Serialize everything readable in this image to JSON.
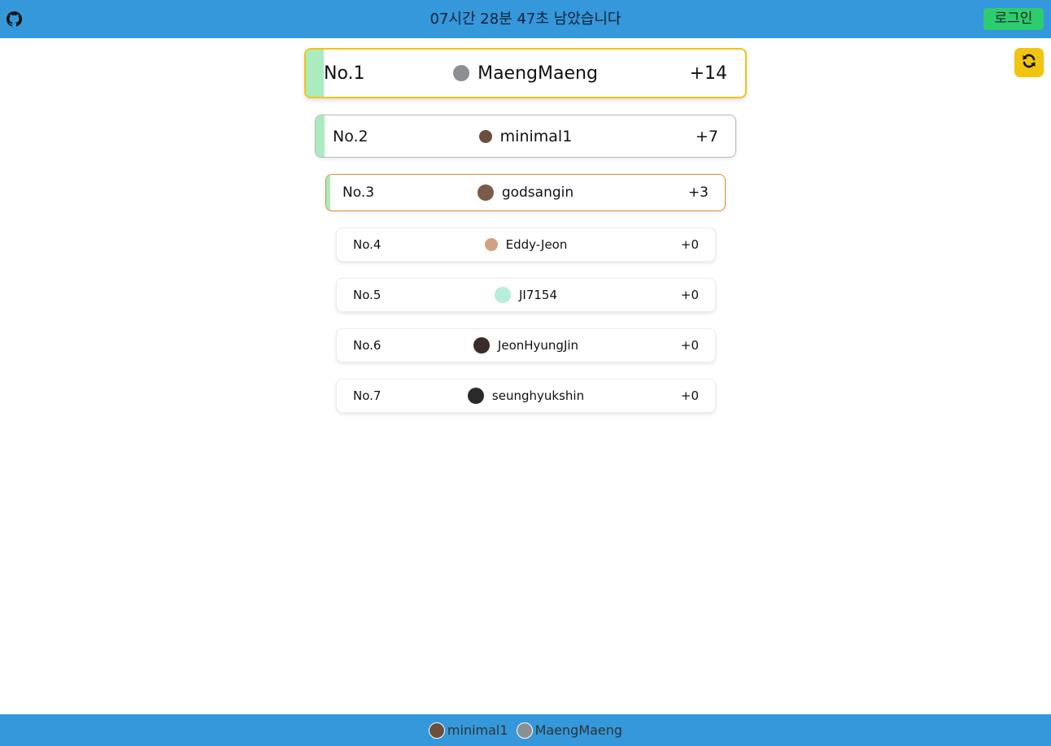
{
  "header": {
    "timer_text": "07시간 28분 47초 남았습니다",
    "login_label": "로그인",
    "github_icon": "github-icon",
    "refresh_icon": "refresh-icon"
  },
  "colors": {
    "header_bg": "#3498db",
    "login_bg": "#2ecc71",
    "refresh_bg": "#f1c40f",
    "progress_fill": "#abebc0",
    "gold_border": "#f1c40f",
    "silver_border": "#b5b5b5",
    "bronze_border": "#d88a3a"
  },
  "ranking": [
    {
      "rank": "No.1",
      "name": "MaengMaeng",
      "score": "+14",
      "avatar_color": "#8a8f94",
      "progress": 1.0
    },
    {
      "rank": "No.2",
      "name": "minimal1",
      "score": "+7",
      "avatar_color": "#6b4e3d",
      "progress": 0.5
    },
    {
      "rank": "No.3",
      "name": "godsangin",
      "score": "+3",
      "avatar_color": "#7a5a48",
      "progress": 0.21
    },
    {
      "rank": "No.4",
      "name": "Eddy-Jeon",
      "score": "+0",
      "avatar_color": "#d2a184",
      "progress": 0
    },
    {
      "rank": "No.5",
      "name": "JI7154",
      "score": "+0",
      "avatar_color": "#b8ecdb",
      "progress": 0
    },
    {
      "rank": "No.6",
      "name": "JeonHyungJin",
      "score": "+0",
      "avatar_color": "#3a2c28",
      "progress": 0
    },
    {
      "rank": "No.7",
      "name": "seunghyukshin",
      "score": "+0",
      "avatar_color": "#2a2a2a",
      "progress": 0
    }
  ],
  "footer": {
    "online_users": [
      {
        "name": "minimal1",
        "avatar_color": "#6b4e3d"
      },
      {
        "name": "MaengMaeng",
        "avatar_color": "#8a8f94"
      }
    ]
  }
}
